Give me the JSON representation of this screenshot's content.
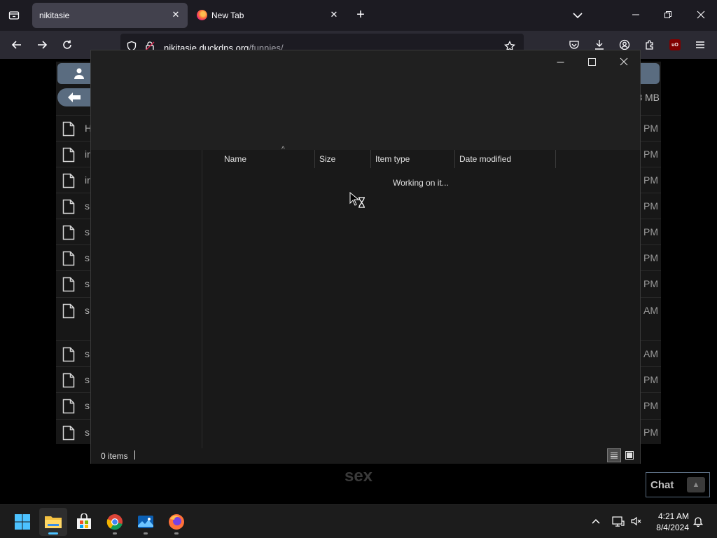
{
  "browser": {
    "tabs": [
      {
        "label": "nikitasie",
        "active": true
      },
      {
        "label": "New Tab",
        "active": false
      }
    ],
    "url": {
      "host": "nikitasie.duckdns.org",
      "path": "/funnies/"
    }
  },
  "page": {
    "size_text": "3 MB",
    "rows": [
      {
        "name": "H",
        "time": "PM"
      },
      {
        "name": "ir",
        "time": "PM"
      },
      {
        "name": "ir",
        "time": "PM"
      },
      {
        "name": "s",
        "time": "PM"
      },
      {
        "name": "s",
        "time": "PM"
      },
      {
        "name": "s",
        "time": "PM"
      },
      {
        "name": "s",
        "time": "PM"
      },
      {
        "name": "s",
        "time": "AM"
      },
      {
        "name": "s",
        "time": "AM"
      },
      {
        "name": "s",
        "time": "PM"
      },
      {
        "name": "s",
        "time": "PM"
      },
      {
        "name": "s",
        "time": "PM"
      }
    ],
    "footer_text": "sex",
    "chat_label": "Chat"
  },
  "dialog": {
    "columns": [
      "Name",
      "Size",
      "Item type",
      "Date modified"
    ],
    "status_message": "Working on it...",
    "item_count": "0 items"
  },
  "taskbar": {
    "apps": [
      "start",
      "file-explorer",
      "microsoft-store",
      "chrome",
      "photos",
      "firefox"
    ],
    "time": "4:21 AM",
    "date": "8/4/2024"
  },
  "colors": {
    "accent": "#4cc2ff",
    "page_button": "#5a6c80"
  }
}
